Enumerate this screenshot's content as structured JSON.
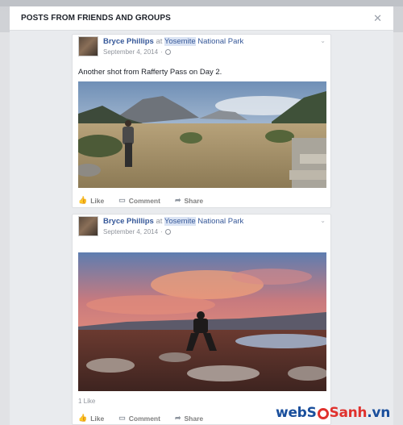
{
  "dialog": {
    "title": "POSTS FROM FRIENDS AND GROUPS",
    "close_icon": "close-icon"
  },
  "posts": [
    {
      "author": "Bryce Phillips",
      "at": "at",
      "place": "Yosemite",
      "place_rest": " National Park",
      "date": "September 4, 2014",
      "privacy_icon": "globe-icon",
      "caption": "Another shot from Rafferty Pass on Day 2.",
      "photo": "hiker-in-alpine-meadow",
      "likes": "",
      "actions": {
        "like": "Like",
        "comment": "Comment",
        "share": "Share"
      }
    },
    {
      "author": "Bryce Phillips",
      "at": "at",
      "place": "Yosemite",
      "place_rest": " National Park",
      "date": "September 4, 2014",
      "privacy_icon": "globe-icon",
      "caption": "",
      "photo": "sunset-lake-silhouette",
      "likes": "1 Like",
      "actions": {
        "like": "Like",
        "comment": "Comment",
        "share": "Share"
      }
    }
  ],
  "watermark": {
    "part1": "web",
    "part2": "S",
    "part3": "Sanh",
    "part4": ".vn"
  },
  "colors": {
    "link": "#365899",
    "meta": "#90949c",
    "dialog_bg": "#e9ebee"
  }
}
